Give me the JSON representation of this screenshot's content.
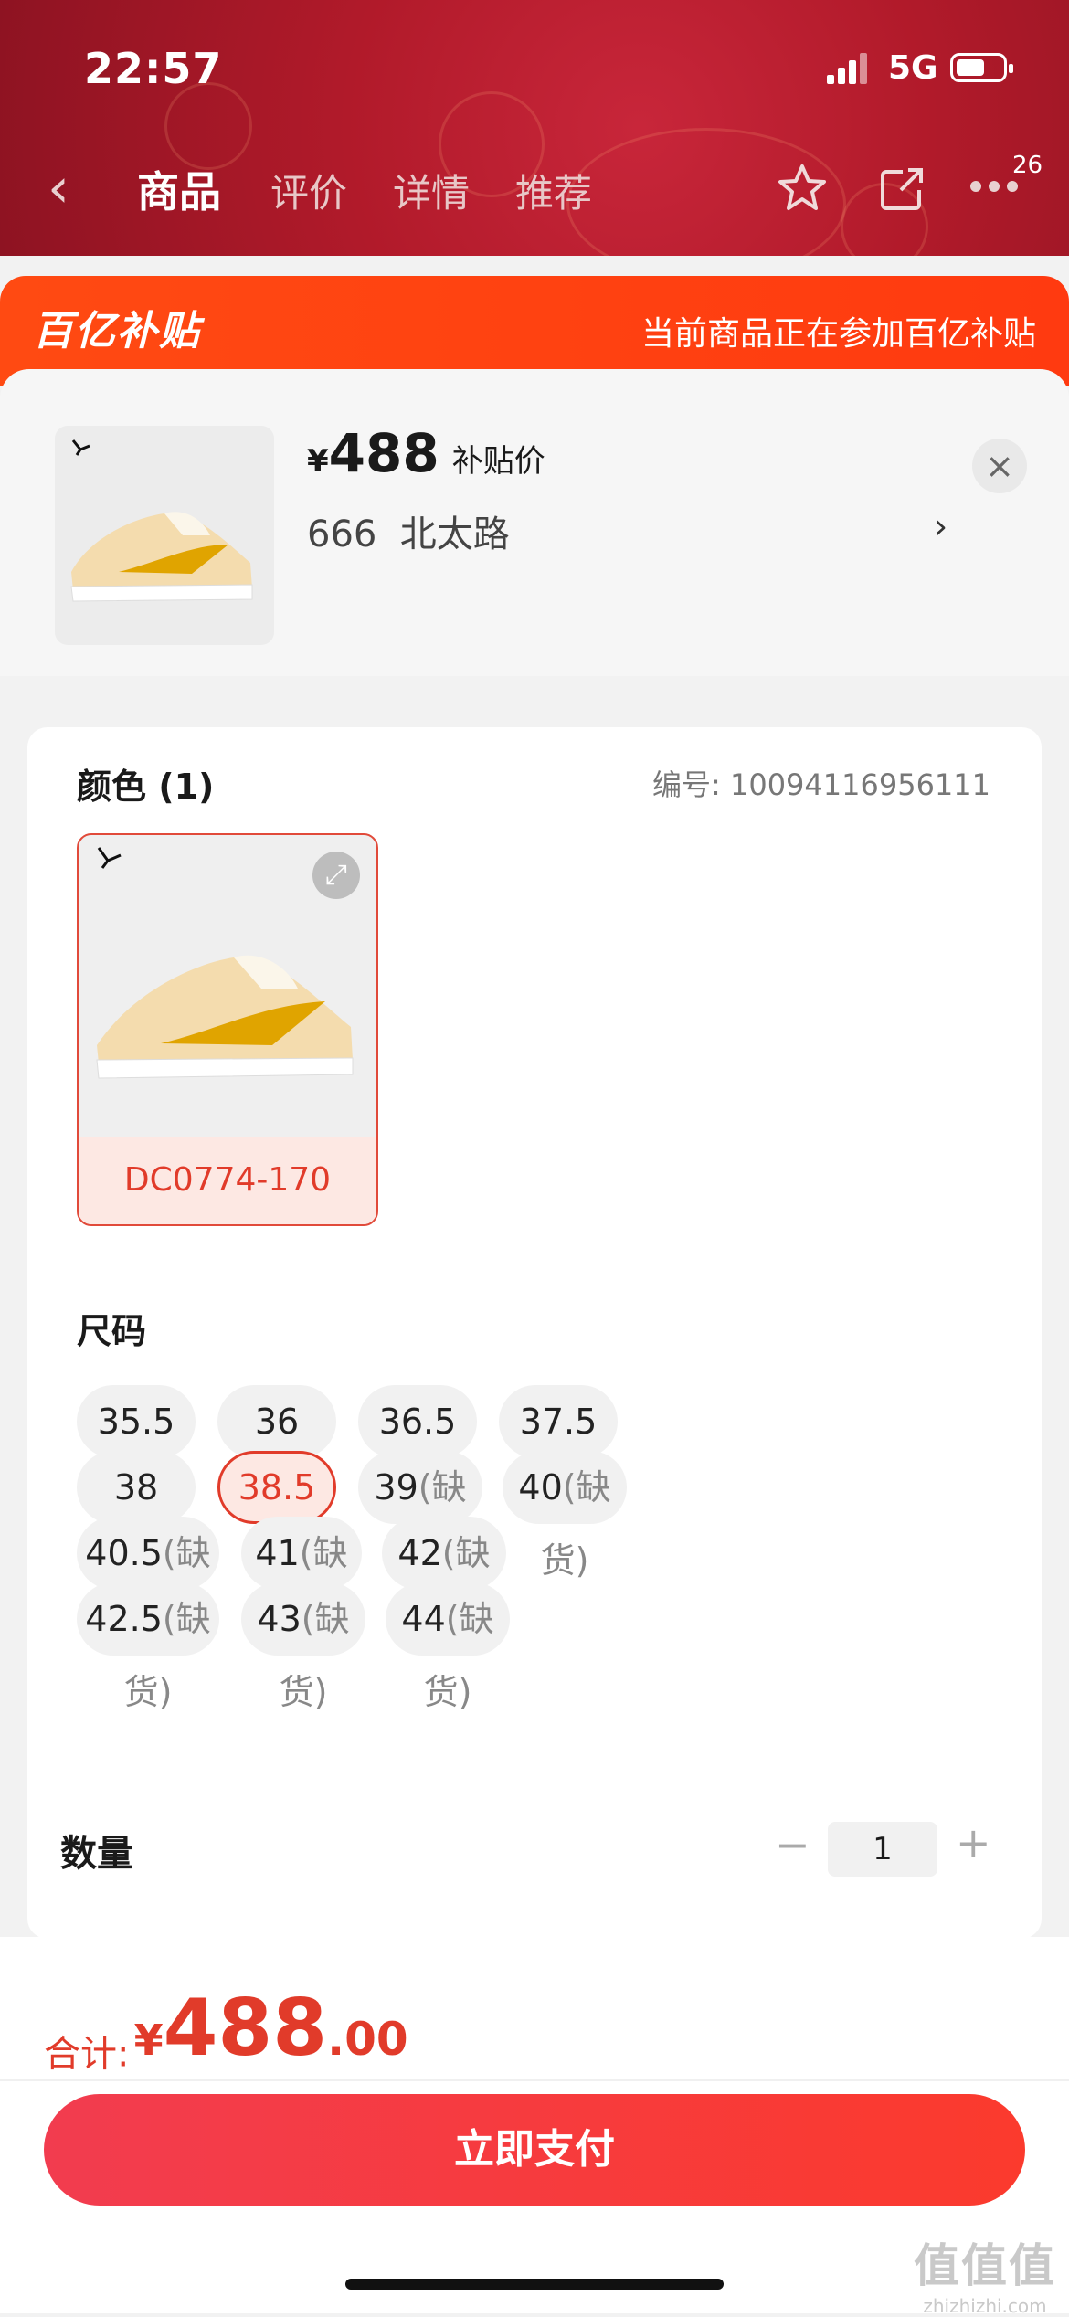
{
  "status_bar": {
    "time": "22:57",
    "network": "5G"
  },
  "nav": {
    "tabs": [
      "商品",
      "评价",
      "详情",
      "推荐"
    ],
    "badge_count": "26"
  },
  "subsidy": {
    "logo": "百亿补贴",
    "note": "当前商品正在参加百亿补贴"
  },
  "product": {
    "currency": "¥",
    "price": "488",
    "price_tag": "补贴价",
    "address": "666  北太路",
    "address_arrow": "›"
  },
  "color_section": {
    "title": "颜色 (1)",
    "sku_label": "编号:",
    "sku_value": "10094116956111",
    "option_code": "DC0774-170"
  },
  "size_section": {
    "title": "尺码",
    "sizes": [
      {
        "size": "35.5",
        "note": ""
      },
      {
        "size": "36",
        "note": ""
      },
      {
        "size": "36.5",
        "note": ""
      },
      {
        "size": "37.5",
        "note": ""
      },
      {
        "size": "38",
        "note": ""
      },
      {
        "size": "38.5",
        "note": ""
      },
      {
        "size": "39",
        "note": "(缺货)"
      },
      {
        "size": "40",
        "note": "(缺货)"
      },
      {
        "size": "40.5",
        "note": "(缺货)"
      },
      {
        "size": "41",
        "note": "(缺货)"
      },
      {
        "size": "42",
        "note": "(缺货)"
      },
      {
        "size": "42.5",
        "note": "(缺货)"
      },
      {
        "size": "43",
        "note": "(缺货)"
      },
      {
        "size": "44",
        "note": "(缺货)"
      }
    ],
    "selected": "38.5"
  },
  "quantity": {
    "label": "数量",
    "value": "1",
    "minus": "−",
    "plus": "+"
  },
  "footer": {
    "total_label": "合计:",
    "currency": "¥",
    "total_int": "488",
    "total_dec": ".00",
    "pay_button": "立即支付"
  },
  "watermark": {
    "main": "值值值",
    "sub": "zhizhizhi.com"
  },
  "colors": {
    "accent": "#e13b2a",
    "subsidy": "#ff4a12",
    "header": "#b11a2a"
  }
}
